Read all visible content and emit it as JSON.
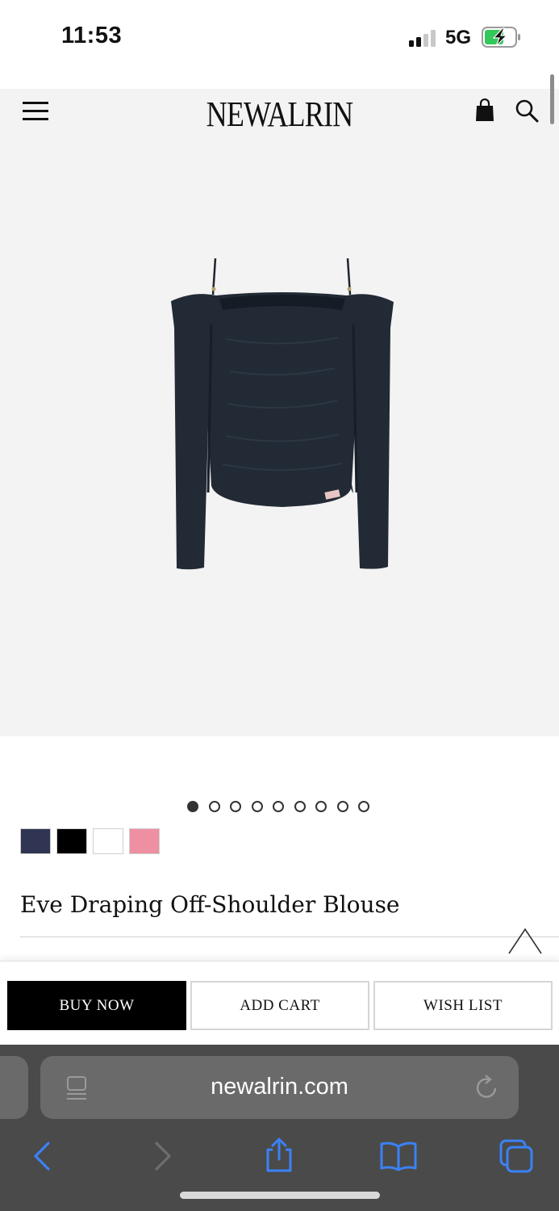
{
  "status_bar": {
    "time": "11:53",
    "network": "5G"
  },
  "header": {
    "brand": "NEWALRIN",
    "icons": [
      "menu-icon",
      "shopping-bag-icon",
      "search-icon"
    ]
  },
  "gallery": {
    "image_count": 9,
    "active_index": 0
  },
  "swatches": [
    {
      "name": "navy",
      "color": "#2f3552"
    },
    {
      "name": "black",
      "color": "#000000"
    },
    {
      "name": "white",
      "color": "#ffffff"
    },
    {
      "name": "pink",
      "color": "#ee8fa2"
    }
  ],
  "product": {
    "title": "Eve Draping Off-Shoulder Blouse"
  },
  "actions": {
    "buy_now": "BUY NOW",
    "add_cart": "ADD CART",
    "wish_list": "WISH LIST"
  },
  "browser": {
    "url": "newalrin.com",
    "toolbar_icons": [
      "back-icon",
      "forward-icon",
      "share-icon",
      "bookmarks-icon",
      "tabs-icon"
    ]
  },
  "colors": {
    "page_bg": "#ffffff",
    "image_bg": "#f3f3f3",
    "accent": "#000000",
    "ios_blue": "#3b82f6",
    "browser_bg": "#4a4a4a"
  }
}
